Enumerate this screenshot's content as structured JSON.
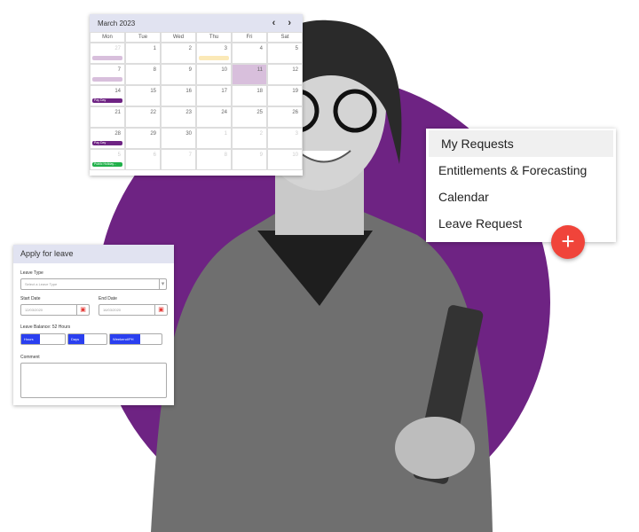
{
  "colors": {
    "accent": "#6e2383",
    "fab": "#f0443a",
    "button": "#2a3ff0",
    "event_purple": "#6e2383",
    "event_green": "#20b04a"
  },
  "calendar": {
    "title": "March 2023",
    "prev_icon": "‹",
    "next_icon": "›",
    "days_of_week": [
      "Mon",
      "Tue",
      "Wed",
      "Thu",
      "Fri",
      "Sat"
    ],
    "weeks": [
      [
        {
          "d": "27",
          "m": true,
          "ev": "light"
        },
        {
          "d": "1"
        },
        {
          "d": "2"
        },
        {
          "d": "3",
          "ev": "yellow"
        },
        {
          "d": "4"
        },
        {
          "d": "5"
        }
      ],
      [
        {
          "d": "7",
          "ev": "light"
        },
        {
          "d": "8"
        },
        {
          "d": "9"
        },
        {
          "d": "10"
        },
        {
          "d": "11",
          "hl": true
        },
        {
          "d": "12"
        }
      ],
      [
        {
          "d": "14",
          "ev": "purple",
          "label": "Pay Day"
        },
        {
          "d": "15"
        },
        {
          "d": "16"
        },
        {
          "d": "17"
        },
        {
          "d": "18"
        },
        {
          "d": "19"
        }
      ],
      [
        {
          "d": "21"
        },
        {
          "d": "22"
        },
        {
          "d": "23"
        },
        {
          "d": "24"
        },
        {
          "d": "25"
        },
        {
          "d": "26"
        }
      ],
      [
        {
          "d": "28",
          "ev": "purple",
          "label": "Pay Day"
        },
        {
          "d": "29"
        },
        {
          "d": "30"
        },
        {
          "d": "1",
          "m": true
        },
        {
          "d": "2",
          "m": true
        },
        {
          "d": "3",
          "m": true
        }
      ],
      [
        {
          "d": "5",
          "m": true,
          "ev": "green",
          "label": "Public Holiday..."
        },
        {
          "d": "6",
          "m": true
        },
        {
          "d": "7",
          "m": true
        },
        {
          "d": "8",
          "m": true
        },
        {
          "d": "9",
          "m": true
        },
        {
          "d": "10",
          "m": true
        }
      ]
    ]
  },
  "menu": {
    "items": [
      "My Requests",
      "Entitlements & Forecasting",
      "Calendar",
      "Leave Request"
    ],
    "fab_icon": "+"
  },
  "form": {
    "title": "Apply for leave",
    "leave_type_label": "Leave Type",
    "leave_type_placeholder": "Select a Leave Type",
    "start_label": "Start Date",
    "start_value": "12/03/2020",
    "end_label": "End Date",
    "end_value": "16/03/2020",
    "balance_label": "Leave Balance: 52 Hours",
    "hours": "Hours",
    "days": "Days",
    "weekend": "Weekend/PH",
    "comment_label": "Comment"
  }
}
